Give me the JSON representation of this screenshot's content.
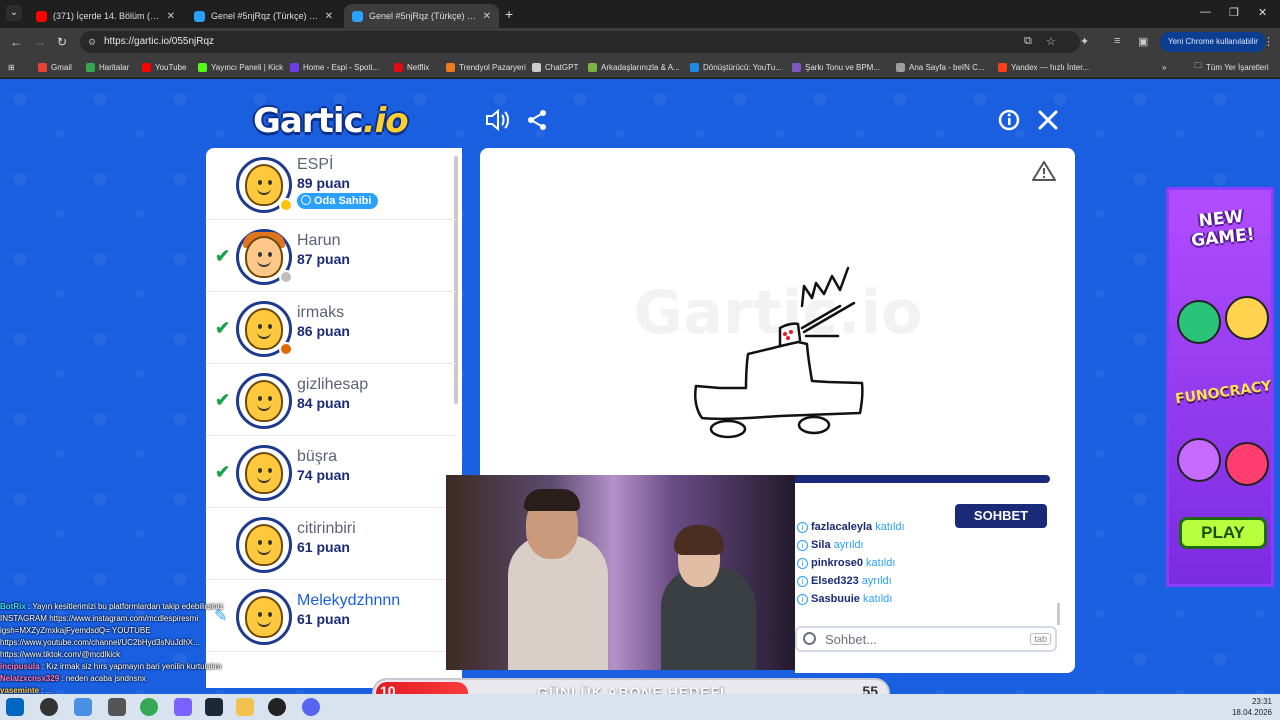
{
  "browser": {
    "tabs": [
      {
        "title": "(371) İçerde 14. Bölüm (Full HD)",
        "active": false,
        "favicon_color": "#ff0000"
      },
      {
        "title": "Genel #5njRqz (Türkçe) - Gartic",
        "active": false,
        "favicon_color": "#2aa0ff"
      },
      {
        "title": "Genel #5njRqz (Türkçe) - Gartic",
        "active": true,
        "favicon_color": "#2aa0ff"
      }
    ],
    "url": "https://gartic.io/055njRqz",
    "chrome_pill": "Yeni Chrome kullanılabilir",
    "bookmarks": [
      {
        "label": "Gmail",
        "color": "#ea4335"
      },
      {
        "label": "Haritalar",
        "color": "#34a853"
      },
      {
        "label": "YouTube",
        "color": "#ff0000"
      },
      {
        "label": "Yayıncı Paneli | Kick",
        "color": "#53fc18"
      },
      {
        "label": "Home - Espi - Spoti...",
        "color": "#6a3de8"
      },
      {
        "label": "Netflix",
        "color": "#e50914"
      },
      {
        "label": "Trendyol Pazaryeri",
        "color": "#f27a1a"
      },
      {
        "label": "ChatGPT",
        "color": "#cccccc"
      },
      {
        "label": "Arkadaşlarınızla & A...",
        "color": "#7cb342"
      },
      {
        "label": "Dönüştürücü: YouTu...",
        "color": "#1e88e5"
      },
      {
        "label": "Şarkı Tonu ve BPM...",
        "color": "#7e57c2"
      },
      {
        "label": "Ana Sayfa - beIN C...",
        "color": "#9e9e9e"
      },
      {
        "label": "Yandex — hızlı İnter...",
        "color": "#fc3f1d"
      }
    ],
    "all_bookmarks": "Tüm Yer İşaretleri"
  },
  "game": {
    "logo_main": "Gartic",
    "logo_suffix": ".io",
    "players": [
      {
        "name": "ESPİ",
        "points": "89 puan",
        "guessed": false,
        "badge": "Oda Sahibi",
        "dot": "#ffc107",
        "hair": false
      },
      {
        "name": "Harun",
        "points": "87 puan",
        "guessed": true,
        "badge": "",
        "dot": "#bdbdbd",
        "hair": true
      },
      {
        "name": "irmaks",
        "points": "86 puan",
        "guessed": true,
        "badge": "",
        "dot": "#e06a00",
        "hair": false
      },
      {
        "name": "gizlihesap",
        "points": "84 puan",
        "guessed": true,
        "badge": "",
        "dot": "",
        "hair": false
      },
      {
        "name": "büşra",
        "points": "74 puan",
        "guessed": true,
        "badge": "",
        "dot": "",
        "hair": false
      },
      {
        "name": "citirinbiri",
        "points": "61 puan",
        "guessed": false,
        "badge": "",
        "dot": "",
        "hair": false
      },
      {
        "name": "Melekydzhnnn",
        "points": "61 puan",
        "guessed": false,
        "badge": "",
        "dot": "",
        "hair": false,
        "highlight": true
      }
    ],
    "chat_tab": "SOHBET",
    "chat": [
      {
        "user": "fazlacaleyla",
        "action": "katıldı"
      },
      {
        "user": "Sila",
        "action": "ayrıldı"
      },
      {
        "user": "pinkrose0",
        "action": "katıldı"
      },
      {
        "user": "Elsed323",
        "action": "ayrıldı"
      },
      {
        "user": "Sasbuuie",
        "action": "katıldı"
      }
    ],
    "chat_placeholder": "Sohbet...",
    "chat_tab_key": "tab",
    "ad": {
      "new_game": "NEW GAME!",
      "fun": "FUNOCRACY",
      "play": "PLAY"
    }
  },
  "stream": {
    "overlay": [
      {
        "name": "BotRix",
        "text": ": Yayın kesitlerimizi bu platformlardan takip edebilirsiniz",
        "cls": "n1"
      },
      {
        "name": "",
        "text": "INSTAGRAM https://www.instagram.com/mcdlespiresmi",
        "cls": ""
      },
      {
        "name": "",
        "text": "igsh=MXZyZmxkajFyemdsdQ= YOUTUBE",
        "cls": ""
      },
      {
        "name": "",
        "text": "https://www.youtube.com/channel/UC2bHyd3sNuJdhX...",
        "cls": ""
      },
      {
        "name": "",
        "text": "https://www.tiktok.com/@mcdlkick",
        "cls": ""
      },
      {
        "name": "incipusula",
        "text": ": Kız irmak siz hırs yapmayın bari yenilin kurtulalım",
        "cls": "n2"
      },
      {
        "name": "Nelalzxcnsx329",
        "text": ": neden acaba jsndnsnx",
        "cls": "n2"
      },
      {
        "name": "yaseminte",
        "text": ": ...",
        "cls": "n3"
      }
    ],
    "goal": {
      "label": "GÜNLÜK ABONE HEDEFİ",
      "current": "10",
      "target": "55",
      "progress": 0.18
    }
  },
  "taskbar": {
    "time": "23:31",
    "date": "18.04.2026"
  }
}
